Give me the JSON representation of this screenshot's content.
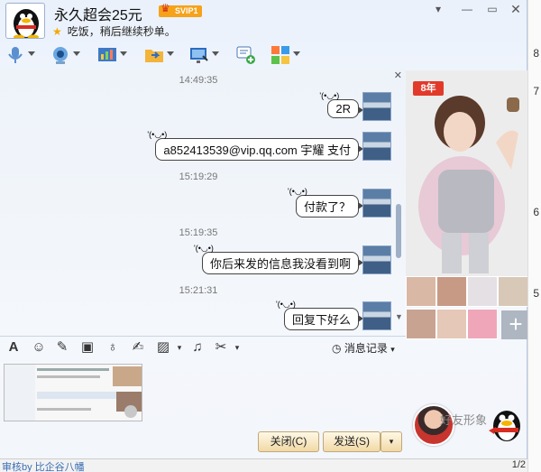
{
  "header": {
    "title": "永久超会25元",
    "vip_badge": "SVIP1",
    "status": "吃饭，稍后继续秒单。"
  },
  "chat": {
    "messages": [
      {
        "time": "14:49:35",
        "text": "2R"
      },
      {
        "time": "",
        "text": "a852413539@vip.qq.com  宇耀  支付"
      },
      {
        "time": "15:19:29",
        "text": "付款了？"
      },
      {
        "time": "15:19:35",
        "text": "你后来发的信息我没看到啊"
      },
      {
        "time": "15:21:31",
        "text": "回复下好么"
      }
    ]
  },
  "input_bar": {
    "history_label": "消息记录"
  },
  "buttons": {
    "close": "关闭(C)",
    "send": "发送(S)"
  },
  "right_panel": {
    "badge": "8年",
    "friend_label": "好友形象",
    "plus": "+"
  },
  "background": {
    "bottom_text": "审核by 比企谷八幡",
    "page_counter": "1/2",
    "right_numbers": [
      "8",
      "7",
      "6",
      "5"
    ]
  },
  "colors": {
    "accent_blue": "#3b6fb5",
    "vip_orange": "#f6a21a",
    "button_gold": "#f1d9a6"
  }
}
